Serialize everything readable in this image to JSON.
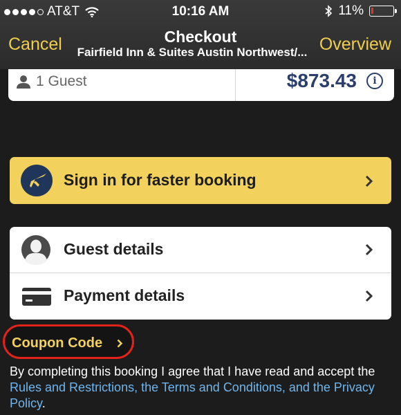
{
  "status_bar": {
    "carrier": "AT&T",
    "time": "10:16 AM",
    "battery_text": "11%",
    "battery_level": 0.11,
    "signal_bars_filled": 4,
    "signal_bars_total": 5
  },
  "nav": {
    "left_label": "Cancel",
    "title": "Checkout",
    "subtitle": "Fairfield Inn & Suites Austin Northwest/...",
    "right_label": "Overview"
  },
  "summary": {
    "guests": "1 Guest",
    "price": "$873.43",
    "info_icon": "info-icon"
  },
  "signin": {
    "label": "Sign in for faster booking",
    "icon": "plane-icon"
  },
  "details": [
    {
      "label": "Guest details",
      "icon": "person-silhouette-icon"
    },
    {
      "label": "Payment details",
      "icon": "credit-card-icon"
    }
  ],
  "coupon": {
    "label": "Coupon Code"
  },
  "legal": {
    "prefix": "By completing this booking I agree that I have read and accept the ",
    "links": "Rules and Restrictions, the Terms and Conditions, and the Privacy Policy",
    "suffix": "."
  },
  "colors": {
    "accent": "#f0cd4b",
    "button_yellow": "#f2d15c",
    "price_navy": "#2c3e6b",
    "link_blue": "#6fb6ee",
    "highlight_red": "#e2231a",
    "battery_red": "#e5332a"
  }
}
